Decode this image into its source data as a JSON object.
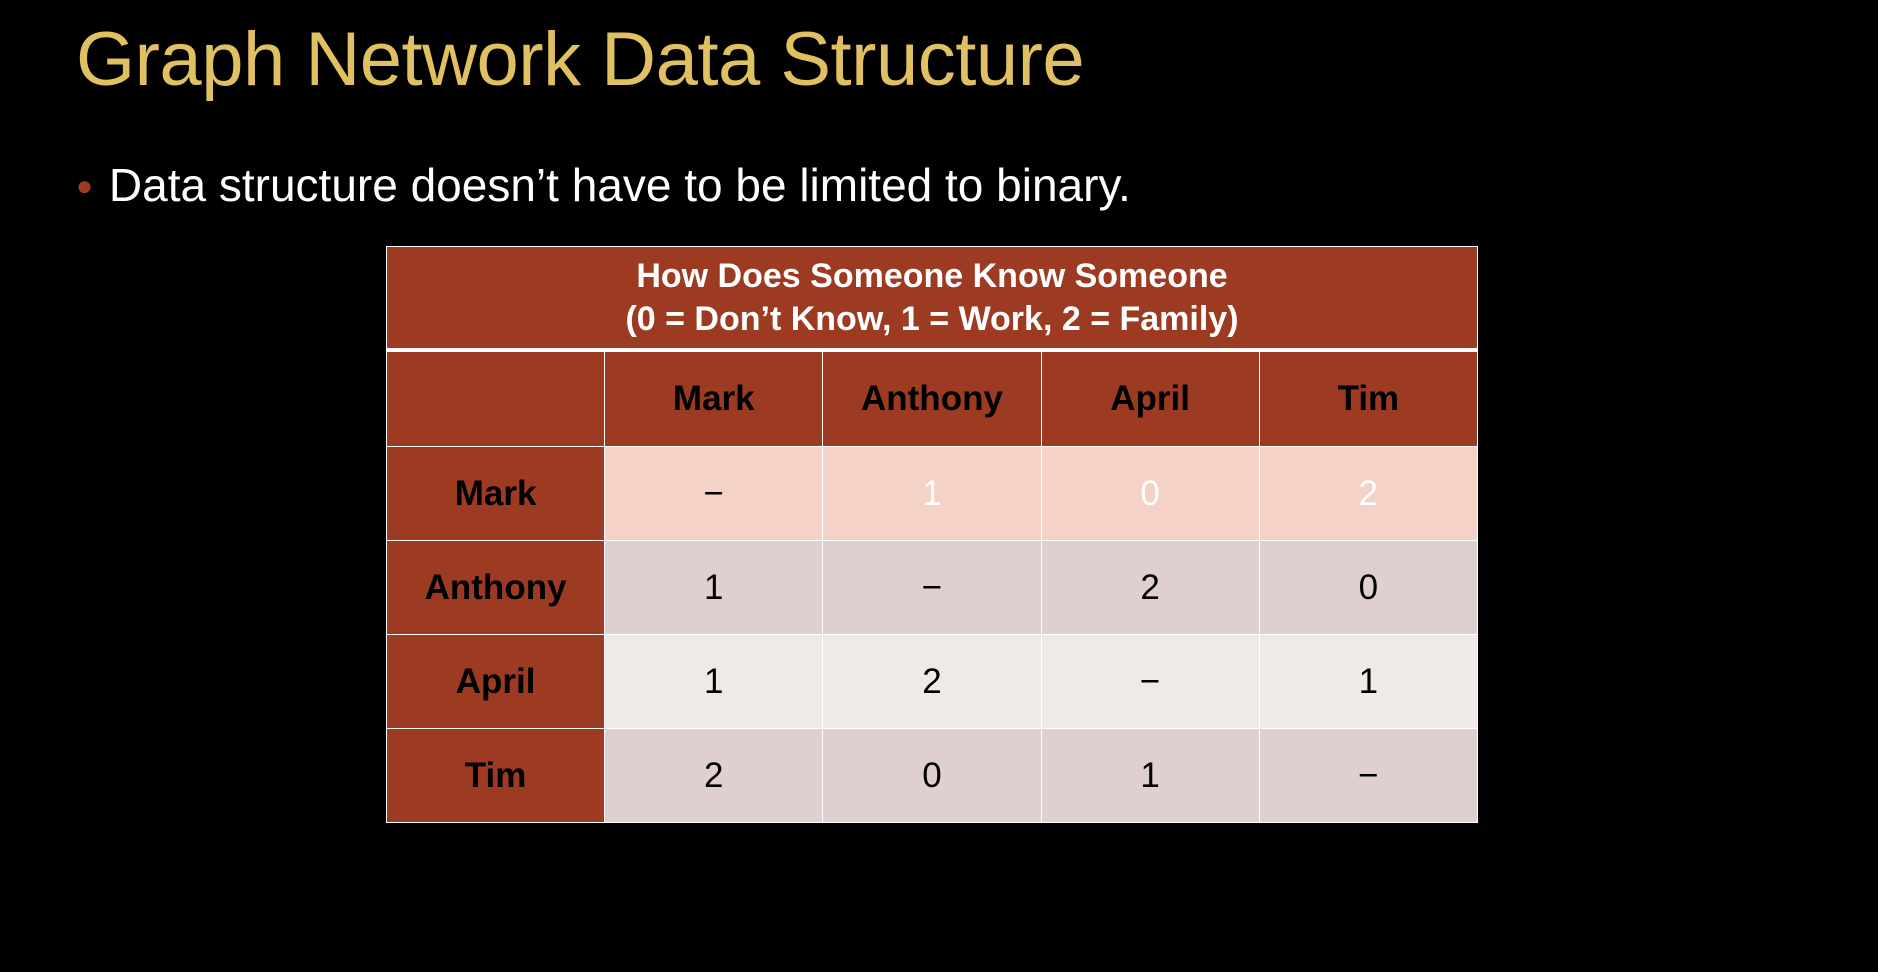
{
  "slide": {
    "title": "Graph Network Data Structure",
    "bullet": "Data structure doesn’t have to be limited to binary."
  },
  "table": {
    "caption_line1": "How Does Someone Know Someone",
    "caption_line2": "(0 = Don’t Know, 1 = Work, 2 = Family)",
    "corner": "",
    "columns": [
      "Mark",
      "Anthony",
      "April",
      "Tim"
    ],
    "rows": [
      {
        "label": "Mark",
        "values": [
          "−",
          "1",
          "0",
          "2"
        ]
      },
      {
        "label": "Anthony",
        "values": [
          "1",
          "−",
          "2",
          "0"
        ]
      },
      {
        "label": "April",
        "values": [
          "1",
          "2",
          "−",
          "1"
        ]
      },
      {
        "label": "Tim",
        "values": [
          "2",
          "0",
          "1",
          "−"
        ]
      }
    ]
  },
  "colors": {
    "title": "#E0C060",
    "header_bg": "#9C3B22",
    "row_mark_bg": "#F4D2C8",
    "row_alt_bg": "#DFCFCF",
    "row_light_bg": "#EFEAE7",
    "background": "#000000"
  }
}
